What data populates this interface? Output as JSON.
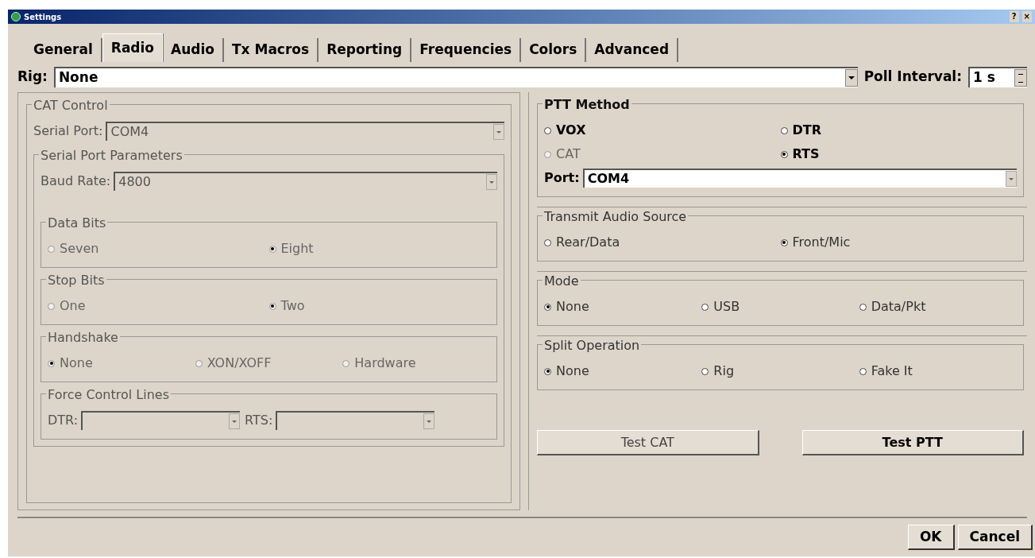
{
  "window": {
    "title": "Settings",
    "help_button": "?",
    "close_button": "×"
  },
  "tabs": [
    {
      "label": "General",
      "selected": false
    },
    {
      "label": "Radio",
      "selected": true
    },
    {
      "label": "Audio",
      "selected": false
    },
    {
      "label": "Tx Macros",
      "selected": false
    },
    {
      "label": "Reporting",
      "selected": false
    },
    {
      "label": "Frequencies",
      "selected": false
    },
    {
      "label": "Colors",
      "selected": false
    },
    {
      "label": "Advanced",
      "selected": false
    }
  ],
  "rig": {
    "label": "Rig:",
    "value": "None"
  },
  "poll_interval": {
    "label": "Poll Interval:",
    "value": "1 s"
  },
  "cat_control": {
    "title": "CAT Control",
    "disabled": true,
    "serial_port": {
      "label": "Serial Port:",
      "value": "COM4"
    },
    "serial_port_parameters": {
      "title": "Serial Port Parameters",
      "baud_rate": {
        "label": "Baud Rate:",
        "value": "4800"
      },
      "groups": [
        {
          "title": "Data Bits",
          "options": [
            {
              "label": "Seven",
              "selected": false
            },
            {
              "label": "Eight",
              "selected": true
            }
          ]
        },
        {
          "title": "Stop Bits",
          "options": [
            {
              "label": "One",
              "selected": false
            },
            {
              "label": "Two",
              "selected": true
            }
          ]
        },
        {
          "title": "Handshake",
          "options": [
            {
              "label": "None",
              "selected": true
            },
            {
              "label": "XON/XOFF",
              "selected": false
            },
            {
              "label": "Hardware",
              "selected": false
            }
          ]
        }
      ],
      "force_control_lines": {
        "title": "Force Control Lines",
        "fields": [
          {
            "label": "DTR:"
          },
          {
            "label": "RTS:"
          }
        ]
      }
    }
  },
  "ptt_method": {
    "title": "PTT Method",
    "options": [
      {
        "label": "VOX",
        "selected": false,
        "disabled": false
      },
      {
        "label": "DTR",
        "selected": false,
        "disabled": false
      },
      {
        "label": "CAT",
        "selected": false,
        "disabled": true
      },
      {
        "label": "RTS",
        "selected": true,
        "disabled": false
      }
    ],
    "port": {
      "label": "Port:",
      "value": "COM4"
    }
  },
  "right_groups": [
    {
      "title": "Transmit Audio Source",
      "options": [
        {
          "label": "Rear/Data",
          "selected": false
        },
        {
          "label": "Front/Mic",
          "selected": true
        }
      ]
    },
    {
      "title": "Mode",
      "options": [
        {
          "label": "None",
          "selected": true
        },
        {
          "label": "USB",
          "selected": false
        },
        {
          "label": "Data/Pkt",
          "selected": false
        }
      ]
    },
    {
      "title": "Split Operation",
      "options": [
        {
          "label": "None",
          "selected": true
        },
        {
          "label": "Rig",
          "selected": false
        },
        {
          "label": "Fake It",
          "selected": false
        }
      ]
    }
  ],
  "test_buttons": [
    {
      "label": "Test CAT",
      "disabled": true
    },
    {
      "label": "Test PTT",
      "disabled": false
    }
  ],
  "buttons": [
    "OK",
    "Cancel"
  ]
}
